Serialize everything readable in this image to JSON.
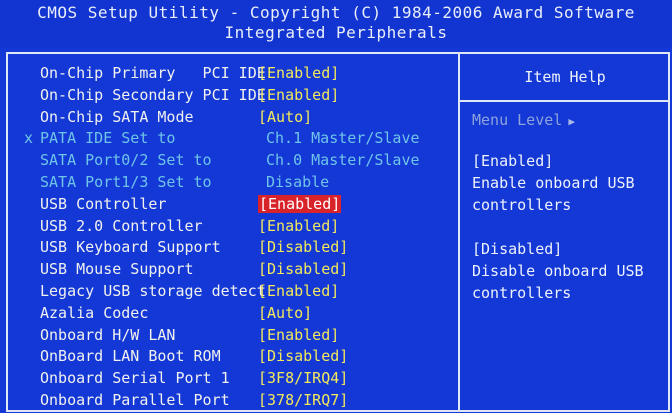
{
  "header": {
    "line1": "CMOS Setup Utility - Copyright (C) 1984-2006 Award Software",
    "line2": "Integrated Peripherals"
  },
  "items": [
    {
      "label": "On-Chip Primary   PCI IDE",
      "value": "[Enabled]",
      "state": "normal"
    },
    {
      "label": "On-Chip Secondary PCI IDE",
      "value": "[Enabled]",
      "state": "normal"
    },
    {
      "label": "On-Chip SATA Mode",
      "value": "[Auto]",
      "state": "normal"
    },
    {
      "label": "PATA IDE Set to",
      "value": "Ch.1 Master/Slave",
      "state": "disabled",
      "marker": "x"
    },
    {
      "label": "SATA Port0/2 Set to",
      "value": "Ch.0 Master/Slave",
      "state": "disabled"
    },
    {
      "label": "SATA Port1/3 Set to",
      "value": "Disable",
      "state": "disabled"
    },
    {
      "label": "USB Controller",
      "value": "[Enabled]",
      "state": "selected"
    },
    {
      "label": "USB 2.0 Controller",
      "value": "[Enabled]",
      "state": "normal"
    },
    {
      "label": "USB Keyboard Support",
      "value": "[Disabled]",
      "state": "normal"
    },
    {
      "label": "USB Mouse Support",
      "value": "[Disabled]",
      "state": "normal"
    },
    {
      "label": "Legacy USB storage detect",
      "value": "[Enabled]",
      "state": "normal"
    },
    {
      "label": "Azalia Codec",
      "value": "[Auto]",
      "state": "normal"
    },
    {
      "label": "Onboard H/W LAN",
      "value": "[Enabled]",
      "state": "normal"
    },
    {
      "label": "OnBoard LAN Boot ROM",
      "value": "[Disabled]",
      "state": "normal"
    },
    {
      "label": "Onboard Serial Port 1",
      "value": "[3F8/IRQ4]",
      "state": "normal"
    },
    {
      "label": "Onboard Parallel Port",
      "value": "[378/IRQ7]",
      "state": "normal"
    }
  ],
  "help": {
    "title": "Item Help",
    "menu_level": "Menu Level",
    "menu_arrow": "▶",
    "lines": [
      "[Enabled]",
      "Enable onboard USB",
      "controllers",
      "",
      "[Disabled]",
      "Disable onboard USB",
      "controllers"
    ]
  },
  "colors": {
    "background": "#1338d6",
    "text": "#f1f1ee",
    "value": "#f3e95a",
    "disabled": "#6fc4e8",
    "highlight": "#d8232a"
  }
}
